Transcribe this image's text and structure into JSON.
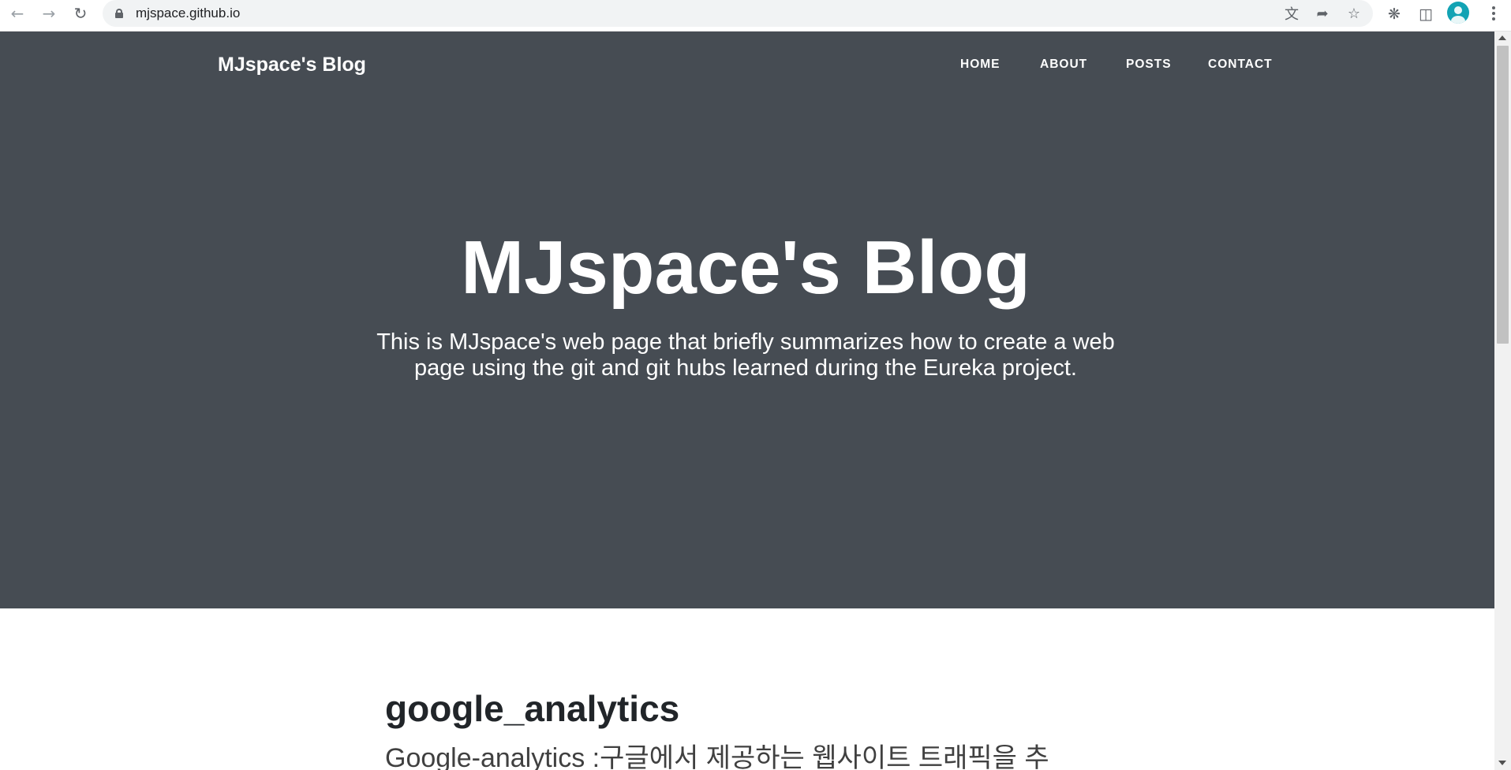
{
  "browser": {
    "url": "mjspace.github.io",
    "icons": [
      "back-arrow-icon",
      "forward-arrow-icon",
      "reload-icon",
      "lock-icon",
      "translate-icon",
      "share-icon",
      "star-icon",
      "extensions-icon",
      "side-panel-icon",
      "profile-avatar-icon",
      "menu-kebab-icon"
    ]
  },
  "site": {
    "brand": "MJspace's Blog",
    "nav": [
      "HOME",
      "ABOUT",
      "POSTS",
      "CONTACT"
    ]
  },
  "hero": {
    "title": "MJspace's Blog",
    "subtitle": "This is MJspace's web page that briefly summarizes how to create a web page using the git and git hubs learned during the Eureka project.",
    "background_color": "#464c53"
  },
  "post": {
    "title": "google_analytics",
    "subtitle": "Google-analytics :구글에서 제공하는 웹사이트 트래픽을 추"
  }
}
